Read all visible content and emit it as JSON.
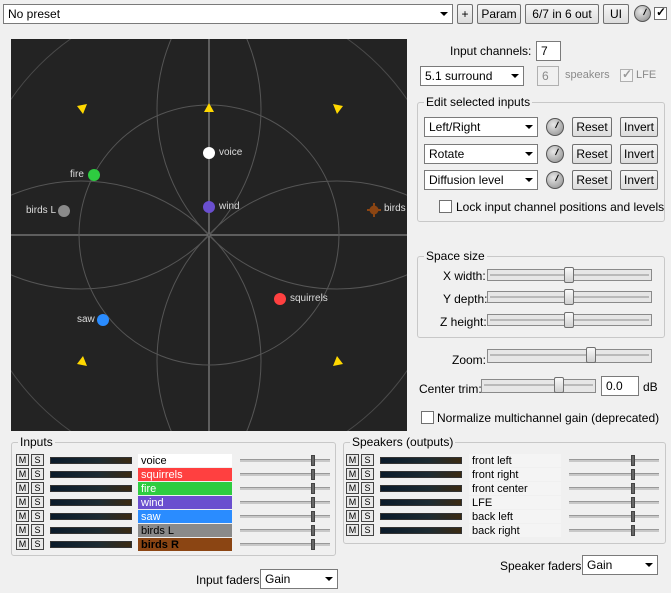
{
  "toolbar": {
    "preset": "No preset",
    "plus_label": "+",
    "param_label": "Param",
    "io_label": "6/7 in 6 out",
    "ui_label": "UI"
  },
  "right_panel": {
    "input_channels_label": "Input channels:",
    "input_channels_value": "7",
    "layout_select": "5.1 surround",
    "speakers_value": "6",
    "speakers_label": "speakers",
    "lfe_label": "LFE",
    "edit_title": "Edit selected inputs",
    "edit_rows": [
      {
        "select": "Left/Right",
        "reset": "Reset",
        "invert": "Invert"
      },
      {
        "select": "Rotate",
        "reset": "Reset",
        "invert": "Invert"
      },
      {
        "select": "Diffusion level",
        "reset": "Reset",
        "invert": "Invert"
      }
    ],
    "lock_label": "Lock input channel positions and levels",
    "space_title": "Space size",
    "space_rows": [
      {
        "label": "X width:",
        "value": 0.5
      },
      {
        "label": "Y depth:",
        "value": 0.5
      },
      {
        "label": "Z height:",
        "value": 0.5
      }
    ],
    "zoom_label": "Zoom:",
    "zoom_value": 0.62,
    "center_trim_label": "Center trim:",
    "center_trim_value": "0.0",
    "center_trim_unit": "dB",
    "center_trim_slider": 0.65,
    "normalize_label": "Normalize multichannel gain (deprecated)"
  },
  "space_view": {
    "sources": [
      {
        "name": "voice",
        "color": "#ffffff"
      },
      {
        "name": "fire",
        "color": "#2ecc40"
      },
      {
        "name": "birds L",
        "color": "#8a8a8a"
      },
      {
        "name": "wind",
        "color": "#6a4fcf"
      },
      {
        "name": "birds",
        "color": "#8b4513"
      },
      {
        "name": "saw",
        "color": "#2a8cff"
      },
      {
        "name": "squirrels",
        "color": "#ff4040"
      }
    ]
  },
  "inputs": {
    "title": "Inputs",
    "m_label": "M",
    "s_label": "S",
    "channels": [
      {
        "name": "voice",
        "bg": "#ffffff",
        "fg": "#000000",
        "fader": 0.82
      },
      {
        "name": "squirrels",
        "bg": "#ff4040",
        "fg": "#ffffff",
        "fader": 0.82
      },
      {
        "name": "fire",
        "bg": "#2ecc40",
        "fg": "#ffffff",
        "fader": 0.82
      },
      {
        "name": "wind",
        "bg": "#6a4fcf",
        "fg": "#ffffff",
        "fader": 0.82
      },
      {
        "name": "saw",
        "bg": "#2a8cff",
        "fg": "#ffffff",
        "fader": 0.82
      },
      {
        "name": "birds L",
        "bg": "#8a8a8a",
        "fg": "#000000",
        "fader": 0.82
      },
      {
        "name": "birds R",
        "bg": "#8b4513",
        "fg": "#000000",
        "fader": 0.82
      }
    ],
    "faders_label": "Input faders:",
    "faders_select": "Gain"
  },
  "speakers": {
    "title": "Speakers (outputs)",
    "m_label": "M",
    "s_label": "S",
    "channels": [
      {
        "name": "front left",
        "fader": 0.82
      },
      {
        "name": "front right",
        "fader": 0.82
      },
      {
        "name": "front center",
        "fader": 0.82
      },
      {
        "name": "LFE",
        "fader": 0.82
      },
      {
        "name": "back left",
        "fader": 0.82
      },
      {
        "name": "back right",
        "fader": 0.82
      }
    ],
    "faders_label": "Speaker faders:",
    "faders_select": "Gain"
  }
}
